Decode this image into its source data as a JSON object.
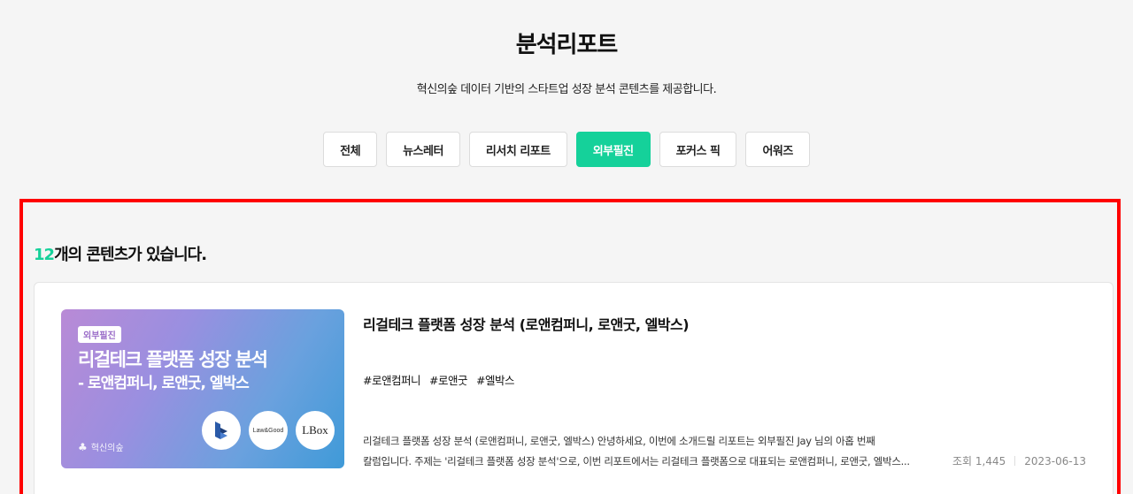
{
  "header": {
    "title": "분석리포트",
    "subtitle": "혁신의숲 데이터 기반의 스타트업 성장 분석 콘텐츠를 제공합니다."
  },
  "tabs": [
    {
      "label": "전체",
      "active": false
    },
    {
      "label": "뉴스레터",
      "active": false
    },
    {
      "label": "리서치 리포트",
      "active": false
    },
    {
      "label": "외부필진",
      "active": true
    },
    {
      "label": "포커스 픽",
      "active": false
    },
    {
      "label": "어워즈",
      "active": false
    }
  ],
  "results": {
    "count": "12",
    "suffix": "개의 콘텐츠가 있습니다."
  },
  "card": {
    "thumbnail": {
      "badge": "외부필진",
      "title_line1": "리걸테크 플랫폼 성장 분석",
      "title_line2": "- 로앤컴퍼니, 로앤굿, 엘박스",
      "brand": "혁신의숲",
      "logo2_text": "Law&Good",
      "logo3_text": "LBox"
    },
    "title": "리걸테크 플랫폼 성장 분석 (로앤컴퍼니, 로앤굿, 엘박스)",
    "tags": [
      "#로앤컴퍼니",
      "#로앤굿",
      "#엘박스"
    ],
    "description_line1": "리걸테크 플랫폼 성장 분석 (로앤컴퍼니, 로앤굿, 엘박스) 안녕하세요, 이번에 소개드릴 리포트는 외부필진 Jay 님의 아홉 번째",
    "description_line2": "칼럼입니다. 주제는 '리걸테크 플랫폼 성장 분석'으로, 이번 리포트에서는 리걸테크 플랫폼으로 대표되는 로앤컴퍼니, 로앤굿, 엘박스...",
    "views_label": "조회 1,445",
    "date": "2023-06-13"
  },
  "colors": {
    "accent": "#15d19a",
    "highlight_border": "#ff0000"
  }
}
